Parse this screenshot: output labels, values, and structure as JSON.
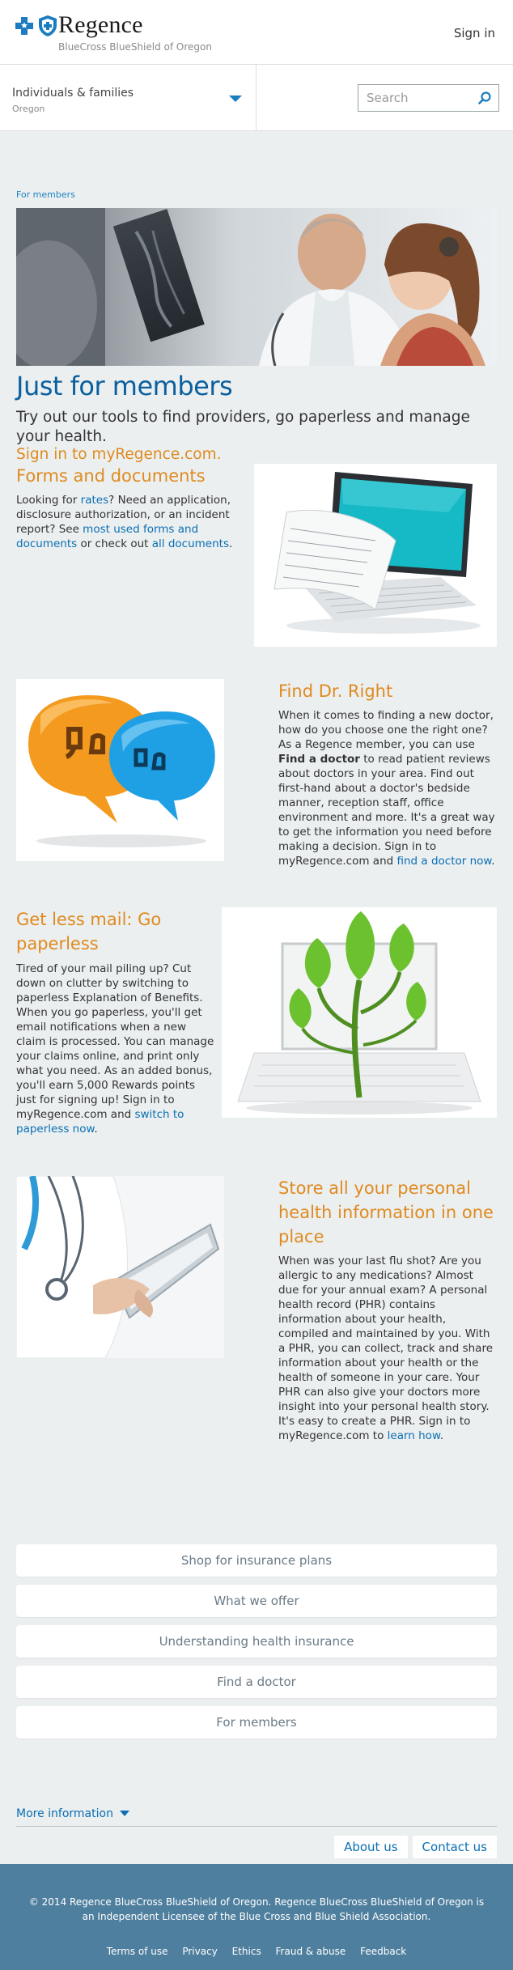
{
  "header": {
    "brand": "Regence",
    "tagline": "BlueCross BlueShield of Oregon",
    "signin": "Sign in"
  },
  "nav": {
    "audience_title": "Individuals & families",
    "audience_sub": "Oregon",
    "search_placeholder": "Search"
  },
  "hero": {
    "breadcrumb": "For members",
    "title": "Just for members",
    "intro": "Try out our tools to find providers, go paperless and manage your health.",
    "intro_link": "Sign in to myRegence.com."
  },
  "forms": {
    "title": "Forms and documents",
    "p1": "Looking for ",
    "link1": "rates",
    "p2": "? Need an application, disclosure authorization, or an incident report? See ",
    "link2": "most used forms and documents",
    "p3": " or check out ",
    "link3": "all documents",
    "p4": "."
  },
  "doctor": {
    "title": "Find Dr. Right",
    "p1": "When it comes to finding a new doctor, how do you choose one the right one? As a Regence member, you can use ",
    "bold": "Find a doctor",
    "p2": " to read patient reviews about doctors in your area. Find out first-hand about a doctor's bedside manner, reception staff, office environment and more. It's a great way to get the information you need before making a decision. Sign in to myRegence.com and ",
    "link": "find a doctor now",
    "p3": "."
  },
  "paperless": {
    "title": "Get less mail: Go paperless",
    "p1": "Tired of your mail piling up? Cut down on clutter by switching to paperless Explanation of Benefits. When you go paperless, you'll get email notifications when a new claim is processed. You can manage your claims online, and print only what you need. As an added bonus, you'll earn 5,000 Rewards points just for signing up! Sign in to myRegence.com and ",
    "link": "switch to paperless now",
    "p2": "."
  },
  "phr": {
    "title": "Store all your personal health information in one place",
    "p1": "When was your last flu shot? Are you allergic to any medications? Almost due for your annual exam?  A personal health record (PHR) contains information about your health, compiled and maintained by you. With a PHR, you can collect, track and share information about your health or the health of someone in your care. Your PHR can also give your doctors more insight into your personal health story. It's easy to create a PHR. Sign in to myRegence.com to ",
    "link": "learn how",
    "p2": "."
  },
  "buttons": [
    "Shop for insurance plans",
    "What we offer",
    "Understanding health insurance",
    "Find a doctor",
    "For members"
  ],
  "more_info": "More information",
  "about_links": [
    "About us",
    "Contact us"
  ],
  "footer": {
    "copyright": "© 2014 Regence BlueCross BlueShield of Oregon. Regence BlueCross BlueShield of Oregon is an Independent Licensee of the Blue Cross and Blue Shield Association.",
    "links": [
      "Terms of use",
      "Privacy",
      "Ethics",
      "Fraud & abuse",
      "Feedback"
    ]
  },
  "colors": {
    "accent_blue": "#0a5f9e",
    "link_blue": "#0a6fb3",
    "orange": "#e08a1e",
    "footer_bg": "#4f7f9e",
    "page_bg": "#ebeff0"
  }
}
